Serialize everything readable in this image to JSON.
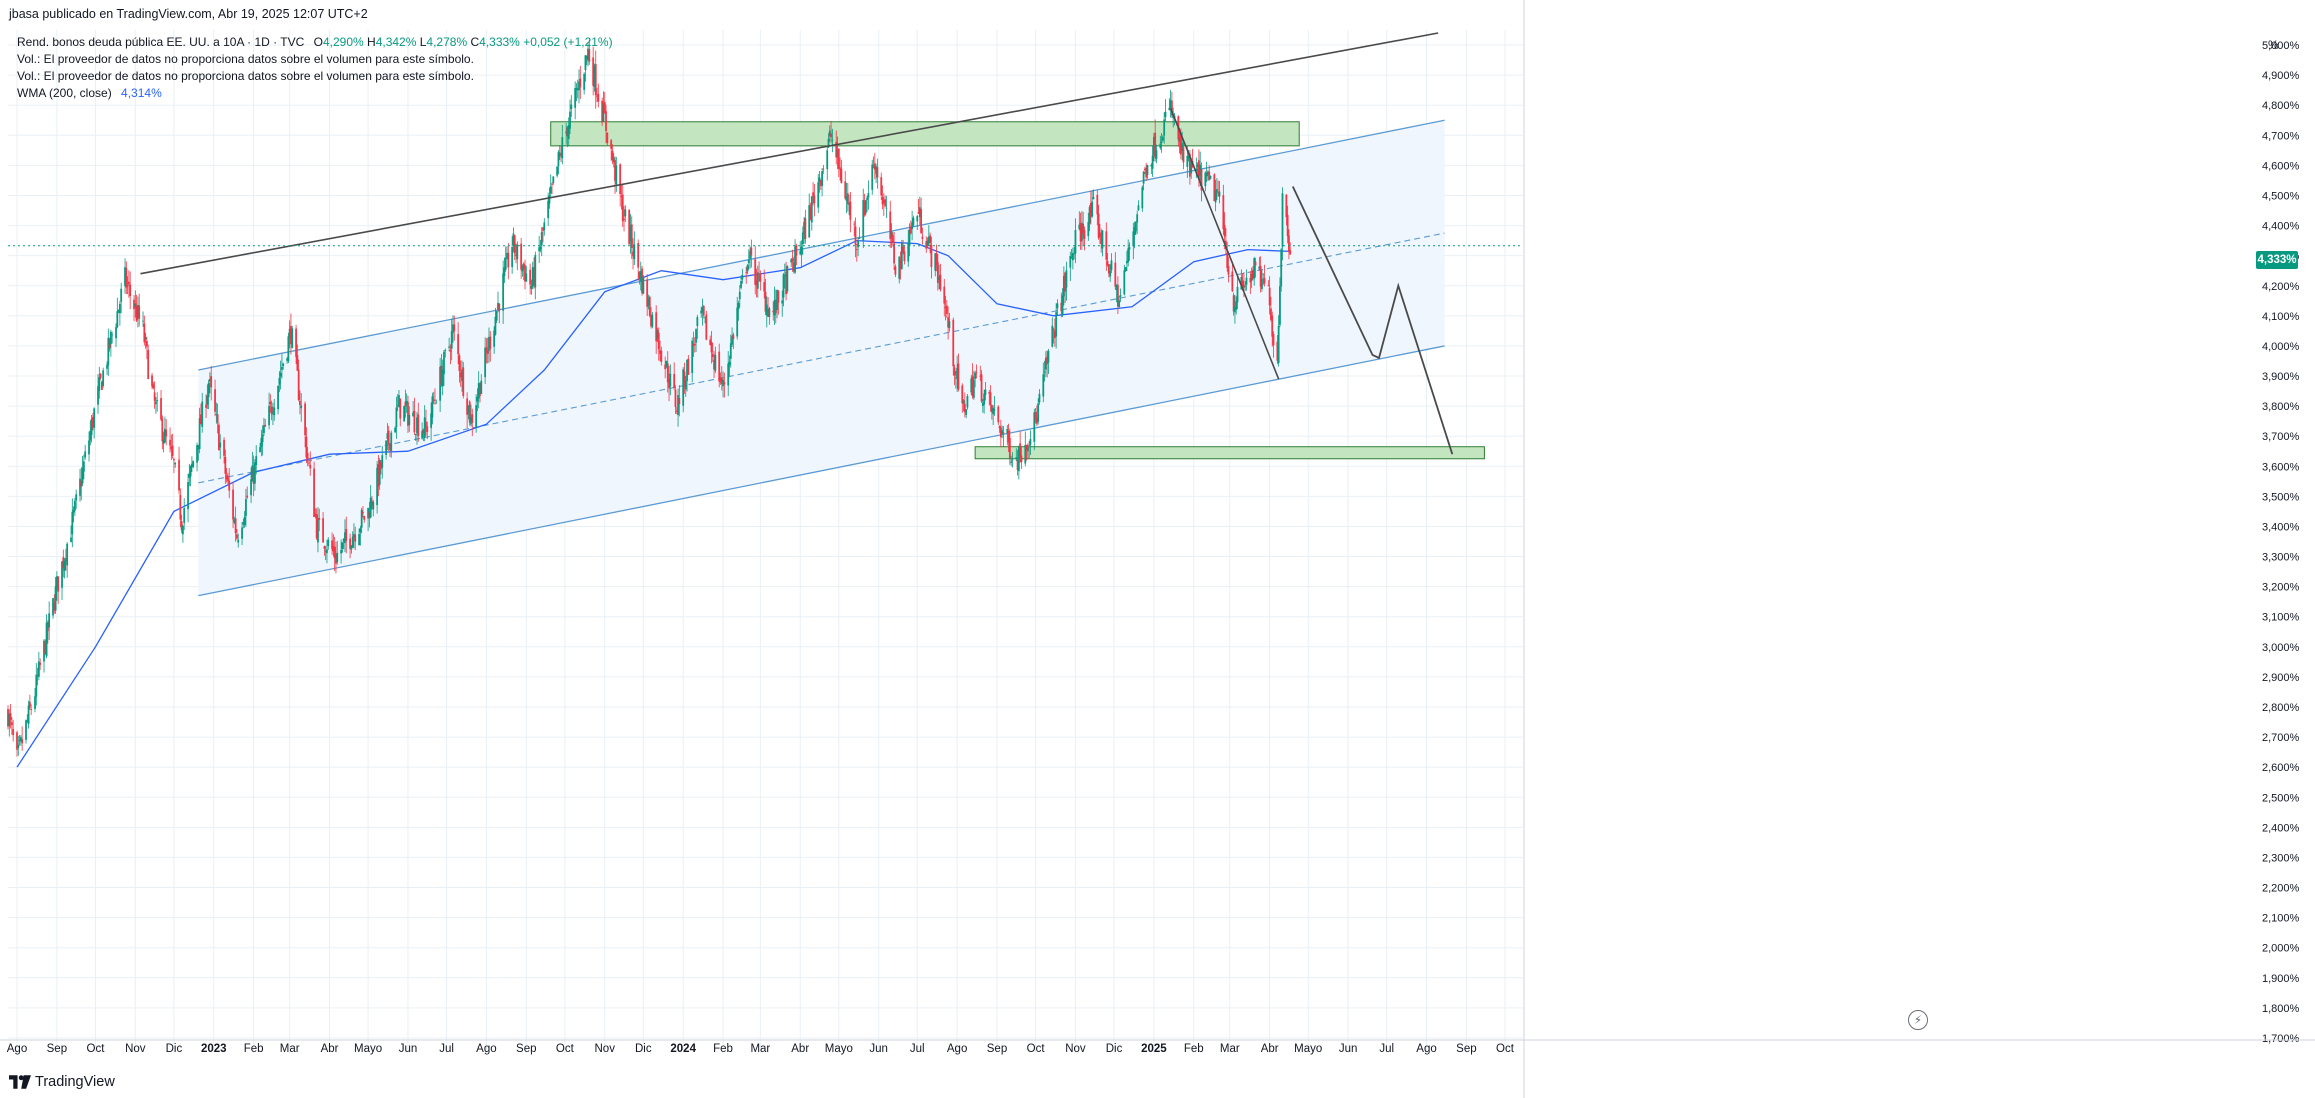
{
  "header": {
    "author_line": "jbasa publicado en TradingView.com, Abr 19, 2025 12:07 UTC+2"
  },
  "legend": {
    "symbol": "Rend. bonos deuda pública EE. UU. a 10A · 1D · TVC",
    "o_label": "O",
    "o_value": "4,290%",
    "h_label": "H",
    "h_value": "4,342%",
    "l_label": "L",
    "l_value": "4,278%",
    "c_label": "C",
    "c_value": "4,333%",
    "change": "+0,052 (+1,21%)",
    "vol_note_1": "Vol.: El proveedor de datos no proporciona datos sobre el volumen para este símbolo.",
    "vol_note_2": "Vol.: El proveedor de datos no proporciona datos sobre el volumen para este símbolo.",
    "wma_label": "WMA (200, close)",
    "wma_value": "4,314%"
  },
  "price_axis": {
    "unit": "%",
    "current_price_badge": "4,333%"
  },
  "footer": {
    "brand": "TradingView"
  },
  "colors": {
    "up": "#089981",
    "down": "#f23645",
    "wma": "#2962ff",
    "channel_fill": "#eef5fd",
    "channel_line": "#5b9bd5",
    "zone_fill": "#c3e6c0",
    "zone_border": "#2e7d32",
    "trendline": "#4a4a4a",
    "grid": "#e9f0f5"
  },
  "chart_data": {
    "type": "candlestick",
    "title": "Rend. bonos deuda pública EE. UU. a 10A",
    "interval": "1D",
    "y_unit": "%",
    "ylim": [
      1.65,
      5.05
    ],
    "y_ticks": [
      "5,000%",
      "4,900%",
      "4,800%",
      "4,700%",
      "4,600%",
      "4,500%",
      "4,400%",
      "4,300%",
      "4,200%",
      "4,100%",
      "4,000%",
      "3,900%",
      "3,800%",
      "3,700%",
      "3,600%",
      "3,500%",
      "3,400%",
      "3,300%",
      "3,200%",
      "3,100%",
      "3,000%",
      "2,900%",
      "2,800%",
      "2,700%",
      "2,600%",
      "2,500%",
      "2,400%",
      "2,300%",
      "2,200%",
      "2,100%",
      "2,000%",
      "1,900%",
      "1,800%",
      "1,700%"
    ],
    "x_ticks": [
      "Ago",
      "Sep",
      "Oct",
      "Nov",
      "Dic",
      "2023",
      "Feb",
      "Mar",
      "Abr",
      "Mayo",
      "Jun",
      "Jul",
      "Ago",
      "Sep",
      "Oct",
      "Nov",
      "Dic",
      "2024",
      "Feb",
      "Mar",
      "Abr",
      "Mayo",
      "Jun",
      "Jul",
      "Ago",
      "Sep",
      "Oct",
      "Nov",
      "Dic",
      "2025",
      "Feb",
      "Mar",
      "Abr",
      "Mayo",
      "Jun",
      "Jul",
      "Ago",
      "Sep",
      "Oct"
    ],
    "x_range": [
      "2022-07-25",
      "2025-10-15"
    ],
    "closing_path": [
      [
        "2022-07-25",
        2.78
      ],
      [
        "2022-08-01",
        2.62
      ],
      [
        "2022-08-15",
        2.85
      ],
      [
        "2022-09-01",
        3.2
      ],
      [
        "2022-09-15",
        3.45
      ],
      [
        "2022-10-01",
        3.8
      ],
      [
        "2022-10-24",
        4.22
      ],
      [
        "2022-11-07",
        4.05
      ],
      [
        "2022-11-15",
        3.82
      ],
      [
        "2022-12-01",
        3.6
      ],
      [
        "2022-12-07",
        3.42
      ],
      [
        "2022-12-28",
        3.88
      ],
      [
        "2023-01-19",
        3.37
      ],
      [
        "2023-02-15",
        3.8
      ],
      [
        "2023-03-02",
        4.05
      ],
      [
        "2023-03-22",
        3.4
      ],
      [
        "2023-04-06",
        3.3
      ],
      [
        "2023-05-01",
        3.45
      ],
      [
        "2023-05-25",
        3.8
      ],
      [
        "2023-06-15",
        3.72
      ],
      [
        "2023-07-06",
        4.05
      ],
      [
        "2023-07-20",
        3.75
      ],
      [
        "2023-08-21",
        4.34
      ],
      [
        "2023-09-05",
        4.2
      ],
      [
        "2023-09-28",
        4.65
      ],
      [
        "2023-10-19",
        4.98
      ],
      [
        "2023-11-01",
        4.75
      ],
      [
        "2023-11-15",
        4.45
      ],
      [
        "2023-12-01",
        4.2
      ],
      [
        "2023-12-27",
        3.8
      ],
      [
        "2024-01-15",
        4.1
      ],
      [
        "2024-02-01",
        3.86
      ],
      [
        "2024-02-20",
        4.3
      ],
      [
        "2024-03-10",
        4.1
      ],
      [
        "2024-04-01",
        4.33
      ],
      [
        "2024-04-25",
        4.7
      ],
      [
        "2024-05-15",
        4.35
      ],
      [
        "2024-05-29",
        4.62
      ],
      [
        "2024-06-15",
        4.25
      ],
      [
        "2024-07-01",
        4.45
      ],
      [
        "2024-07-20",
        4.2
      ],
      [
        "2024-08-05",
        3.78
      ],
      [
        "2024-08-15",
        3.9
      ],
      [
        "2024-09-16",
        3.62
      ],
      [
        "2024-10-01",
        3.75
      ],
      [
        "2024-10-15",
        4.05
      ],
      [
        "2024-11-01",
        4.35
      ],
      [
        "2024-11-15",
        4.45
      ],
      [
        "2024-12-05",
        4.15
      ],
      [
        "2024-12-26",
        4.6
      ],
      [
        "2025-01-14",
        4.79
      ],
      [
        "2025-01-25",
        4.6
      ],
      [
        "2025-02-10",
        4.55
      ],
      [
        "2025-02-20",
        4.5
      ],
      [
        "2025-03-04",
        4.15
      ],
      [
        "2025-03-20",
        4.25
      ],
      [
        "2025-04-01",
        4.17
      ],
      [
        "2025-04-04",
        4.01
      ],
      [
        "2025-04-07",
        3.96
      ],
      [
        "2025-04-11",
        4.49
      ],
      [
        "2025-04-17",
        4.33
      ]
    ],
    "wma_200_path": [
      [
        "2022-08-01",
        2.6
      ],
      [
        "2022-10-01",
        3.0
      ],
      [
        "2022-12-01",
        3.45
      ],
      [
        "2023-02-01",
        3.58
      ],
      [
        "2023-04-01",
        3.64
      ],
      [
        "2023-06-01",
        3.65
      ],
      [
        "2023-08-01",
        3.74
      ],
      [
        "2023-09-15",
        3.92
      ],
      [
        "2023-11-01",
        4.18
      ],
      [
        "2023-12-15",
        4.25
      ],
      [
        "2024-02-01",
        4.22
      ],
      [
        "2024-04-01",
        4.26
      ],
      [
        "2024-05-15",
        4.35
      ],
      [
        "2024-07-01",
        4.34
      ],
      [
        "2024-07-25",
        4.3
      ],
      [
        "2024-09-01",
        4.14
      ],
      [
        "2024-10-15",
        4.1
      ],
      [
        "2024-12-15",
        4.13
      ],
      [
        "2025-02-01",
        4.28
      ],
      [
        "2025-03-15",
        4.32
      ],
      [
        "2025-04-17",
        4.314
      ]
    ]
  },
  "drawings": {
    "channel": {
      "upper": [
        [
          "2022-12-20",
          3.92
        ],
        [
          "2025-08-15",
          4.75
        ]
      ],
      "lower": [
        [
          "2022-12-20",
          3.17
        ],
        [
          "2025-08-15",
          4.0
        ]
      ],
      "mid": [
        [
          "2022-12-20",
          3.545
        ],
        [
          "2025-08-15",
          4.375
        ]
      ]
    },
    "resistance_line": [
      [
        "2022-11-05",
        4.24
      ],
      [
        "2025-08-10",
        5.04
      ]
    ],
    "zones": [
      {
        "name": "resistance-zone",
        "x": [
          "2023-09-20",
          "2025-04-24"
        ],
        "y": [
          4.665,
          4.745
        ]
      },
      {
        "name": "support-zone",
        "x": [
          "2024-08-15",
          "2025-09-15"
        ],
        "y": [
          3.625,
          3.665
        ]
      }
    ],
    "projection": [
      [
        "2025-04-19",
        4.53
      ],
      [
        "2025-06-20",
        3.97
      ],
      [
        "2025-06-25",
        3.96
      ],
      [
        "2025-07-10",
        4.2
      ],
      [
        "2025-08-21",
        3.64
      ]
    ],
    "drop_line": [
      [
        "2025-01-14",
        4.79
      ],
      [
        "2025-04-08",
        3.89
      ]
    ]
  }
}
